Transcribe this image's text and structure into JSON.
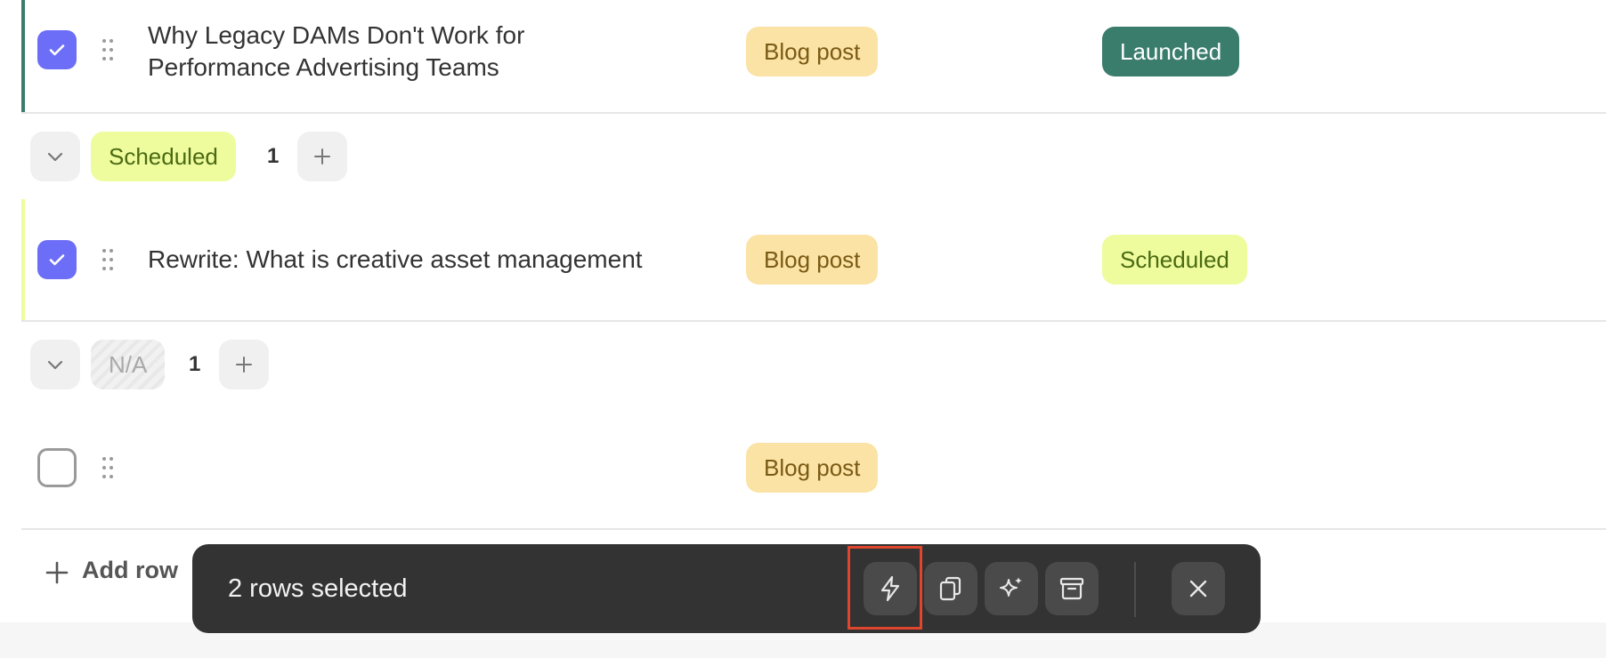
{
  "rows": [
    {
      "title": "Why Legacy DAMs Don't Work for\nPerformance Advertising Teams",
      "type": "Blog post",
      "status": "Launched",
      "checked": true
    },
    {
      "title": "Rewrite: What is creative asset management",
      "type": "Blog post",
      "status": "Scheduled",
      "checked": true
    },
    {
      "title": "",
      "type": "Blog post",
      "status": "",
      "checked": false
    }
  ],
  "groups": [
    {
      "label": "Scheduled",
      "count": "1"
    },
    {
      "label": "N/A",
      "count": "1"
    }
  ],
  "add_row_label": "Add row",
  "selection_toolbar": {
    "label": "2 rows selected",
    "actions": [
      "lightning-icon",
      "duplicate-icon",
      "sparkles-icon",
      "archive-icon"
    ],
    "close": "close-icon"
  },
  "colors": {
    "accent": "#6d6ef7",
    "launched": "#3a7d6d",
    "scheduled": "#eefc9e",
    "blog_post": "#fbe3a6",
    "toolbar": "#333333",
    "highlight": "#e0452d"
  }
}
